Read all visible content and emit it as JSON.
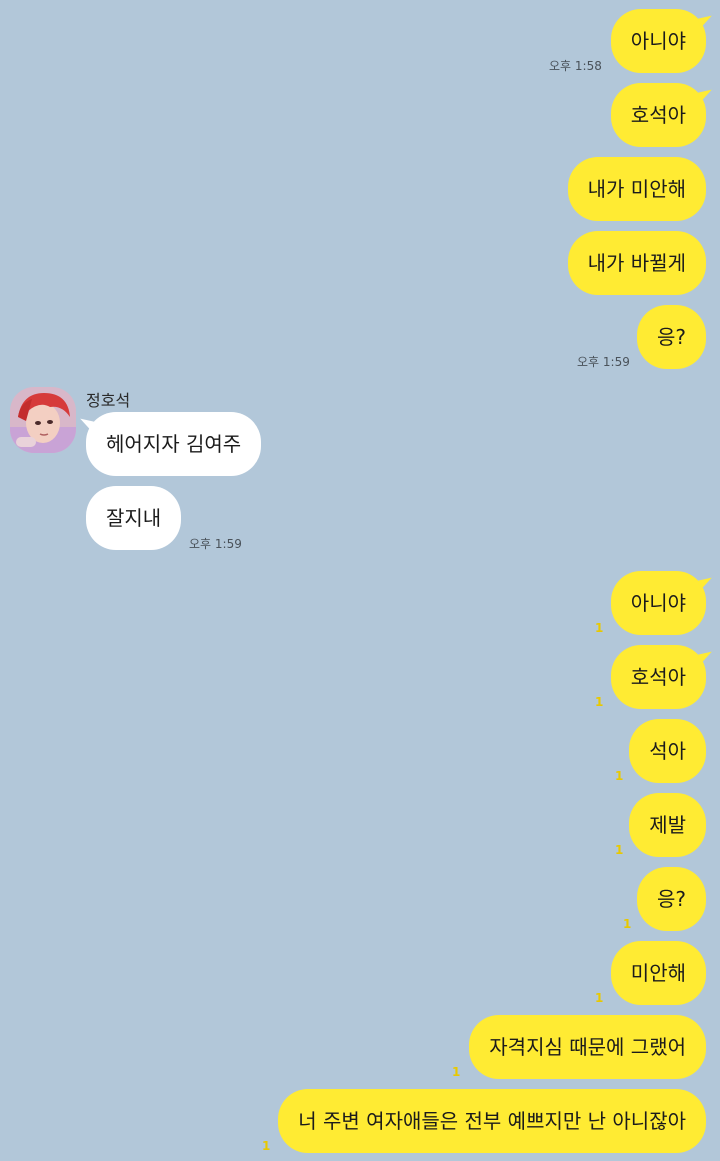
{
  "chat": {
    "sent_first": [
      {
        "text": "아니야"
      },
      {
        "text": "호석아"
      },
      {
        "text": "내가 미안해"
      },
      {
        "text": "내가 바뀔게"
      },
      {
        "text": "응?"
      }
    ],
    "time_1_58": "오후 1:58",
    "time_1_59_me": "오후 1:59",
    "contact": {
      "name": "정호석",
      "messages": [
        "헤어지자 김여주",
        "잘지내"
      ],
      "time": "오후 1:59"
    },
    "sent_second": [
      {
        "text": "아니야",
        "unread": "1"
      },
      {
        "text": "호석아",
        "unread": "1"
      },
      {
        "text": "석아",
        "unread": "1"
      },
      {
        "text": "제발",
        "unread": "1"
      },
      {
        "text": "응?",
        "unread": "1"
      },
      {
        "text": "미안해",
        "unread": "1"
      },
      {
        "text": "자격지심 때문에 그랬어",
        "unread": "1"
      },
      {
        "text": "너 주변 여자애들은 전부 예쁘지만 난 아니잖아",
        "unread": "1"
      }
    ]
  },
  "colors": {
    "background": "#b2c7d9",
    "my_bubble": "#ffeb33",
    "their_bubble": "#ffffff",
    "unread_count": "#e8c800"
  }
}
